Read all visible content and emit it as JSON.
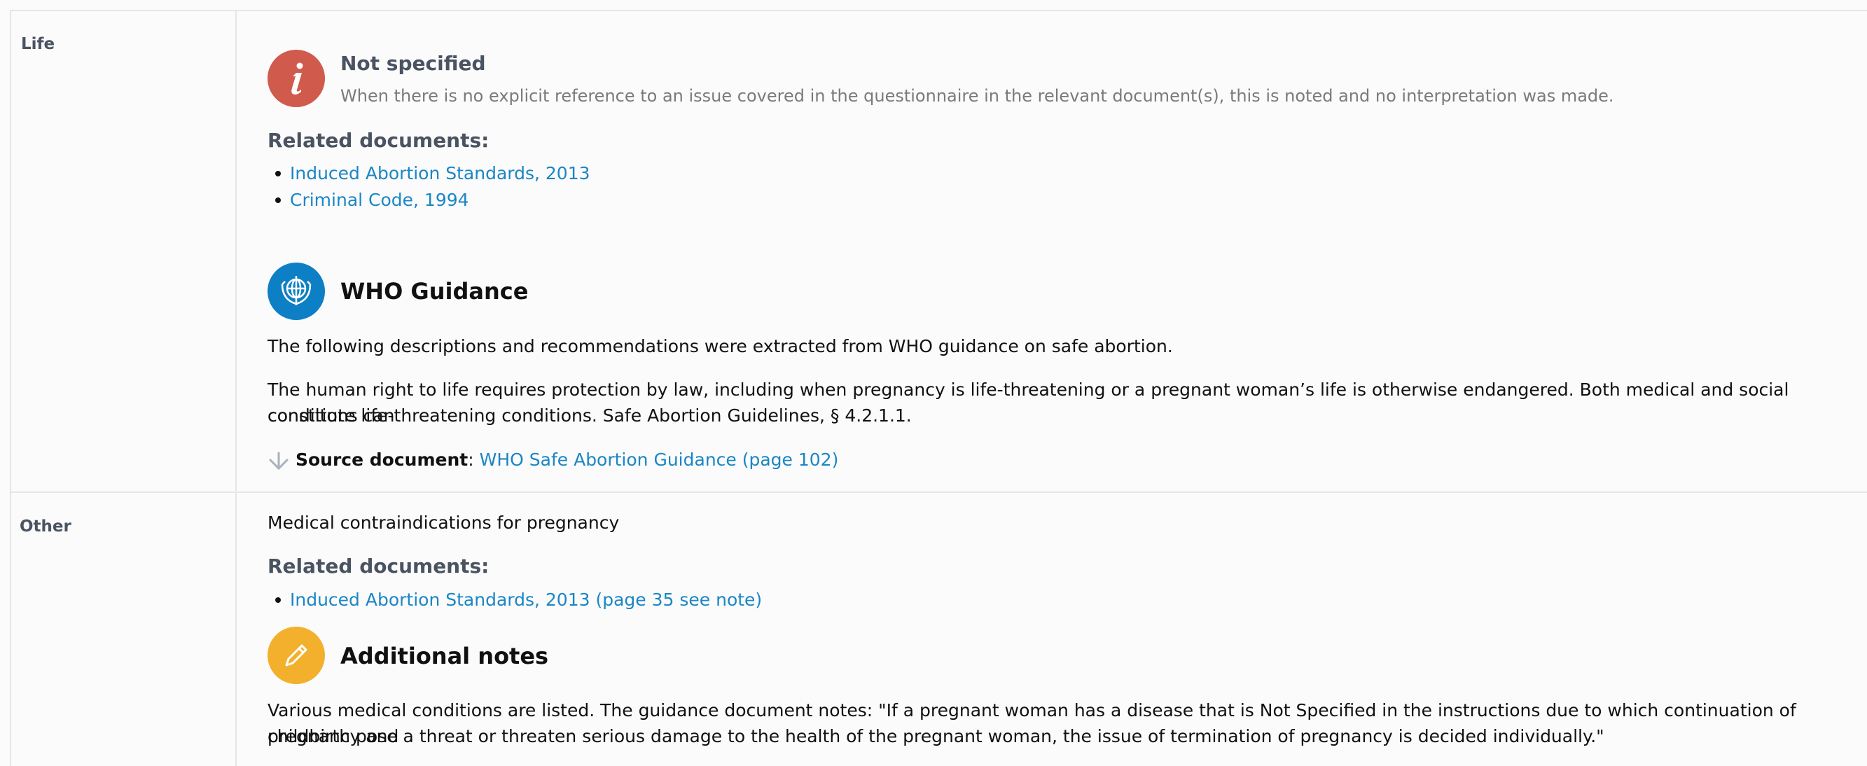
{
  "rows": [
    {
      "label": "Life",
      "not_specified": {
        "title": "Not specified",
        "description": "When there is no explicit reference to an issue covered in the questionnaire in the relevant document(s), this is noted and no interpretation was made."
      },
      "related_heading": "Related documents:",
      "related_documents": [
        "Induced Abortion Standards, 2013",
        "Criminal Code, 1994"
      ],
      "who": {
        "title": "WHO Guidance",
        "intro": "The following descriptions and recommendations were extracted from WHO guidance on safe abortion.",
        "paragraph_line1": "The human right to life requires protection by law, including when pregnancy is life-threatening or a pregnant woman’s life is otherwise endangered. Both medical and social conditions can",
        "paragraph_line2": "constitute life-threatening conditions. Safe Abortion Guidelines, § 4.2.1.1.",
        "source_label": "Source document",
        "source_separator": ":",
        "source_link": "WHO Safe Abortion Guidance (page 102)"
      }
    },
    {
      "label": "Other",
      "text": "Medical contraindications for pregnancy",
      "related_heading": "Related documents:",
      "related_documents": [
        "Induced Abortion Standards, 2013 (page 35 see note)"
      ],
      "notes": {
        "title": "Additional notes",
        "line1": "Various medical conditions are listed. The guidance document notes: \"If a pregnant woman has a disease that is Not Specified in the instructions due to which continuation of pregnancy and",
        "line2": "childbirth pose a threat or threaten serious damage to the health of the pregnant woman, the issue of termination of pregnancy is decided individually.\""
      }
    }
  ],
  "icons": {
    "not_specified": "info-icon",
    "who": "who-emblem-icon",
    "notes": "pencil-icon",
    "source": "arrow-down-icon"
  },
  "colors": {
    "info": "#d05a4c",
    "who": "#0d7fc5",
    "notes": "#f3b02c",
    "link": "#1b86c4"
  }
}
